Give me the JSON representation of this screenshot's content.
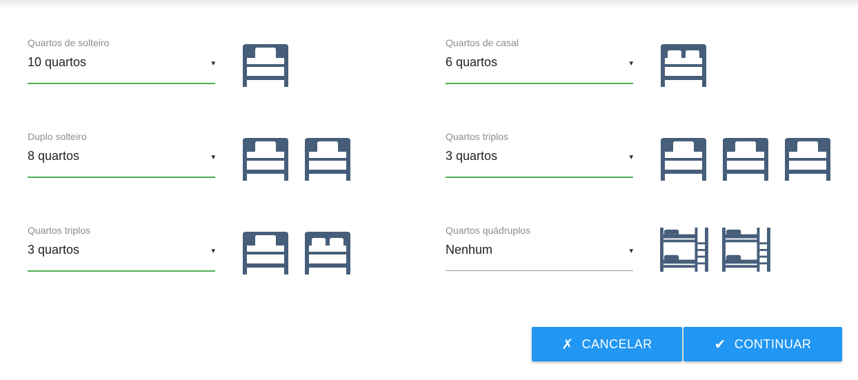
{
  "colors": {
    "accent_green": "#4caf50",
    "button_blue": "#2196f3",
    "icon_slate": "#465e7a"
  },
  "rooms": [
    {
      "label": "Quartos de solteiro",
      "value": "10 quartos",
      "icons": [
        "single-bed-icon"
      ]
    },
    {
      "label": "Quartos de casal",
      "value": "6 quartos",
      "icons": [
        "double-bed-icon"
      ]
    },
    {
      "label": "Duplo solteiro",
      "value": "8 quartos",
      "icons": [
        "single-bed-icon",
        "single-bed-icon"
      ]
    },
    {
      "label": "Quartos triplos",
      "value": "3 quartos",
      "icons": [
        "single-bed-icon",
        "single-bed-icon",
        "single-bed-icon"
      ]
    },
    {
      "label": "Quartos triplos",
      "value": "3 quartos",
      "icons": [
        "single-bed-icon",
        "double-bed-icon"
      ]
    },
    {
      "label": "Quartos quádruplos",
      "value": "Nenhum",
      "icons": [
        "bunk-bed-icon",
        "bunk-bed-icon"
      ]
    }
  ],
  "dropdown_arrow": "▾",
  "actions": {
    "cancel_icon": "✗",
    "cancel_label": "CANCELAR",
    "continue_icon": "✔",
    "continue_label": "CONTINUAR"
  }
}
